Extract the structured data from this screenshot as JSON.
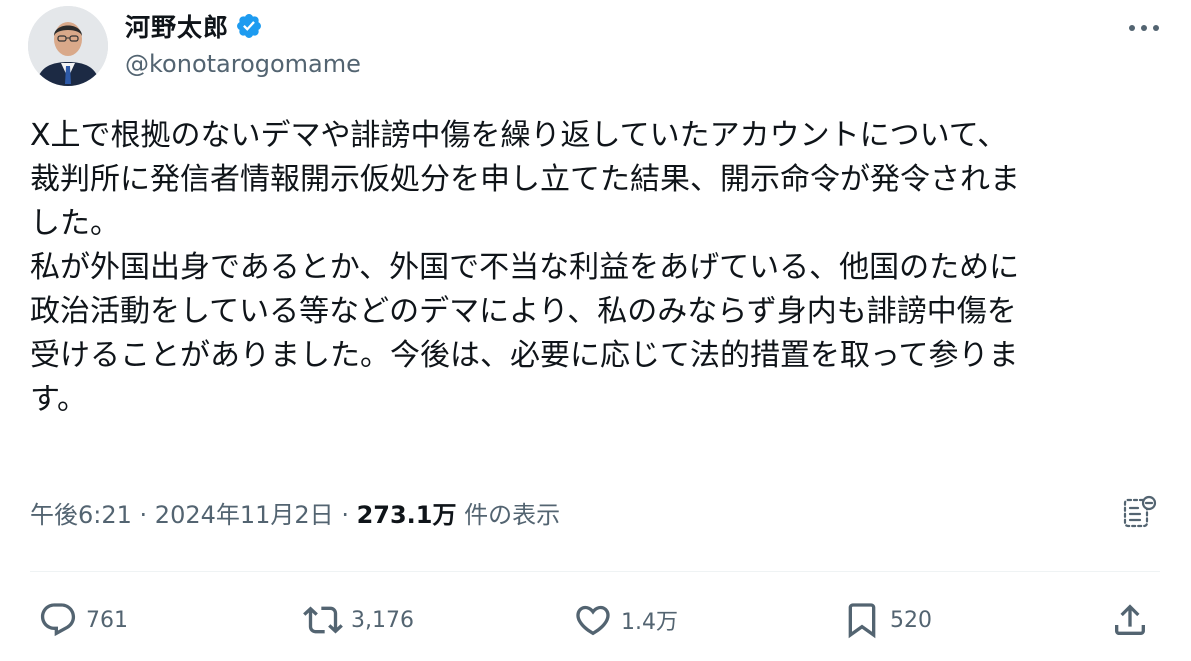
{
  "author": {
    "display_name": "河野太郎",
    "handle": "@konotarogomame",
    "verified": true
  },
  "tweet": {
    "lines": [
      "X上で根拠のないデマや誹謗中傷を繰り返していたアカウントについて、",
      "裁判所に発信者情報開示仮処分を申し立てた結果、開示命令が発令されま",
      "した。",
      "私が外国出身であるとか、外国で不当な利益をあげている、他国のために",
      "政治活動をしている等などのデマにより、私のみならず身内も誹謗中傷を",
      "受けることがありました。今後は、必要に応じて法的措置を取って参りま",
      "す。"
    ]
  },
  "meta": {
    "time": "午後6:21",
    "date": "2024年11月2日",
    "separator": " · ",
    "views_count": "273.1万",
    "views_label": " 件の表示"
  },
  "actions": {
    "reply_count": "761",
    "retweet_count": "3,176",
    "like_count": "1.4万",
    "bookmark_count": "520"
  },
  "colors": {
    "verified_badge": "#1d9bf0",
    "secondary_text": "#536471",
    "primary_text": "#0f1419"
  }
}
